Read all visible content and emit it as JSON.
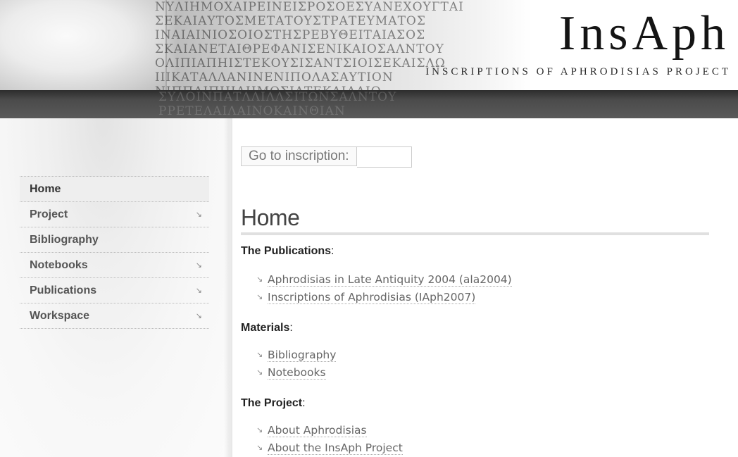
{
  "header": {
    "logo_title": "InsAph",
    "logo_subtitle": "Inscriptions of Aphrodisias Project"
  },
  "goto": {
    "label": "Go to inscription:",
    "input_value": ""
  },
  "sidebar": {
    "items": [
      {
        "label": "Home",
        "has_submenu": false,
        "active": true
      },
      {
        "label": "Project",
        "has_submenu": true,
        "active": false
      },
      {
        "label": "Bibliography",
        "has_submenu": false,
        "active": false
      },
      {
        "label": "Notebooks",
        "has_submenu": true,
        "active": false
      },
      {
        "label": "Publications",
        "has_submenu": true,
        "active": false
      },
      {
        "label": "Workspace",
        "has_submenu": true,
        "active": false
      }
    ]
  },
  "main": {
    "title": "Home",
    "sections": [
      {
        "heading": "The Publications",
        "links": [
          "Aphrodisias in Late Antiquity 2004 (ala2004)",
          "Inscriptions of Aphrodisias (IAph2007)"
        ]
      },
      {
        "heading": "Materials",
        "links": [
          "Bibliography",
          "Notebooks"
        ]
      },
      {
        "heading": "The Project",
        "links": [
          "About Aphrodisias",
          "About the InsAph Project"
        ]
      }
    ]
  },
  "colors": {
    "header_band": "#4b4b4b",
    "nav_active_bg": "#eeeeee",
    "link_text": "#666666",
    "title_rule": "#e0e0e0"
  },
  "icons": {
    "submenu_arrow": "arrow-down-right-icon",
    "list_bullet": "arrow-down-right-icon"
  }
}
